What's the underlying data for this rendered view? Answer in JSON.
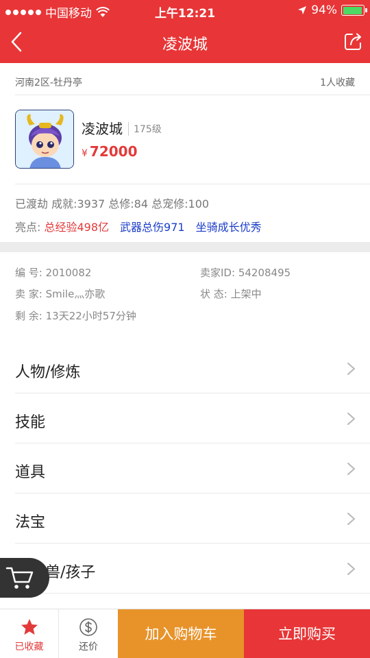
{
  "status_bar": {
    "carrier": "中国移动",
    "time": "上午12:21",
    "battery": "94%",
    "battery_level": 0.94
  },
  "nav": {
    "title": "凌波城",
    "back_icon": "chevron-left-icon",
    "share_icon": "share-icon"
  },
  "header": {
    "server": "河南2区-牡丹亭",
    "favorites": "1人收藏"
  },
  "role": {
    "name": "凌波城",
    "level": "175级",
    "price_symbol": "¥",
    "price": "72000"
  },
  "stats": "已渡劫 成就:3937 总修:84 总宠修:100",
  "highlights": {
    "label": "亮点:",
    "items": [
      "总经验498亿",
      "武器总伤971",
      "坐骑成长优秀"
    ],
    "colors": [
      "#e23a3a",
      "#1a3cc8",
      "#1a3cc8"
    ]
  },
  "meta": {
    "id_label": "编  号:",
    "id_value": "2010082",
    "seller_id_label": "卖家ID:",
    "seller_id_value": "54208495",
    "seller_label": "卖  家:",
    "seller_value": "Smile灬亦歌",
    "state_label": "状  态:",
    "state_value": "上架中",
    "remaining_label": "剩  余:",
    "remaining_value": "13天22小时57分钟"
  },
  "menu": [
    "人物/修炼",
    "技能",
    "道具",
    "法宝",
    "召唤兽/孩子"
  ],
  "bottom": {
    "favorited": "已收藏",
    "bargain": "还价",
    "add_to_cart": "加入购物车",
    "buy_now": "立即购买"
  },
  "colors": {
    "brand_red": "#e83537",
    "price_red": "#e23a3a",
    "cart_orange": "#e8932a"
  }
}
